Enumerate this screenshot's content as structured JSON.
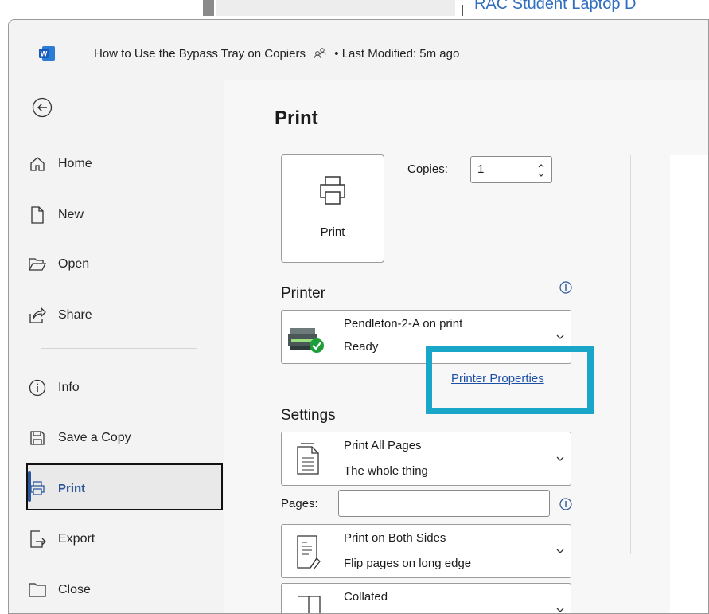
{
  "background_window": {
    "text": "RAC Student Laptop D"
  },
  "titlebar": {
    "app_icon": "word-logo-icon",
    "title": "How to Use the Bypass Tray on Copiers",
    "coauthor_icon": "people-icon",
    "modified": "• Last Modified: 5m ago"
  },
  "sidebar": {
    "back_icon": "back-arrow-icon",
    "items": [
      {
        "label": "Home",
        "icon": "home-icon"
      },
      {
        "label": "New",
        "icon": "new-document-icon"
      },
      {
        "label": "Open",
        "icon": "folder-open-icon"
      },
      {
        "label": "Share",
        "icon": "share-icon"
      },
      {
        "label": "Info",
        "icon": "info-icon"
      },
      {
        "label": "Save a Copy",
        "icon": "save-icon"
      },
      {
        "label": "Print",
        "icon": "printer-icon",
        "selected": true
      },
      {
        "label": "Export",
        "icon": "export-icon"
      },
      {
        "label": "Close",
        "icon": "close-folder-icon"
      }
    ]
  },
  "print": {
    "title": "Print",
    "button_label": "Print",
    "copies_label": "Copies:",
    "copies_value": "1",
    "printer_heading": "Printer",
    "printer_name": "Pendleton-2-A on print",
    "printer_status": "Ready",
    "printer_properties": "Printer Properties",
    "settings_heading": "Settings",
    "settings": [
      {
        "line1": "Print All Pages",
        "line2": "The whole thing"
      },
      {
        "line1": "Print on Both Sides",
        "line2": "Flip pages on long edge"
      },
      {
        "line1": "Collated",
        "line2": ""
      }
    ],
    "pages_label": "Pages:",
    "pages_value": ""
  },
  "colors": {
    "accent": "#2b579a",
    "highlight": "#1aa6c8",
    "link": "#1d4fa5"
  }
}
